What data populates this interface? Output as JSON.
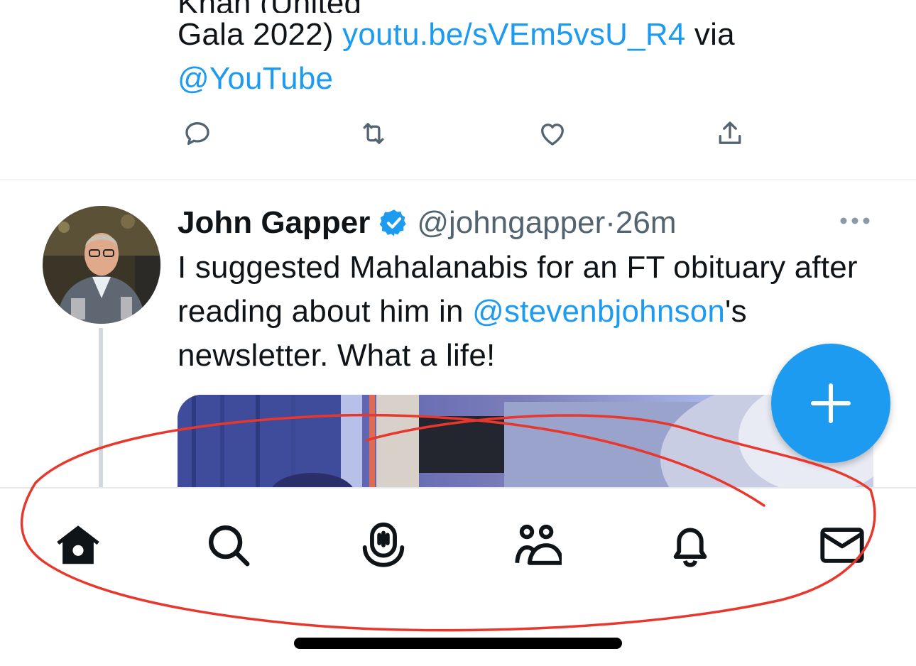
{
  "previous_tweet": {
    "line1_clipped": "Ghazal Pakistan Sings by Ustad Rahat Fateh Ali Khan (United",
    "line2_text_start": "Gala 2022) ",
    "line2_link": "youtu.be/sVEm5vsU_R4",
    "line2_text_end": " via",
    "line3_mention": "@YouTube"
  },
  "tweet": {
    "author_name": "John Gapper",
    "handle": "@johngapper",
    "separator": " · ",
    "time": "26m",
    "body_part1": "I suggested Mahalanabis for an FT obituary after reading about him in ",
    "body_mention": "@stevenbjohnson",
    "body_part2": "'s newsletter. What a life!"
  },
  "actions": [
    "reply-icon",
    "retweet-icon",
    "like-icon",
    "share-icon"
  ],
  "tabs": [
    "home-icon",
    "search-icon",
    "spaces-icon",
    "communities-icon",
    "notifications-icon",
    "messages-icon"
  ],
  "colors": {
    "accent": "#1d9bf0",
    "text": "#0f1419",
    "muted": "#536471",
    "annotation": "#e8372c"
  }
}
